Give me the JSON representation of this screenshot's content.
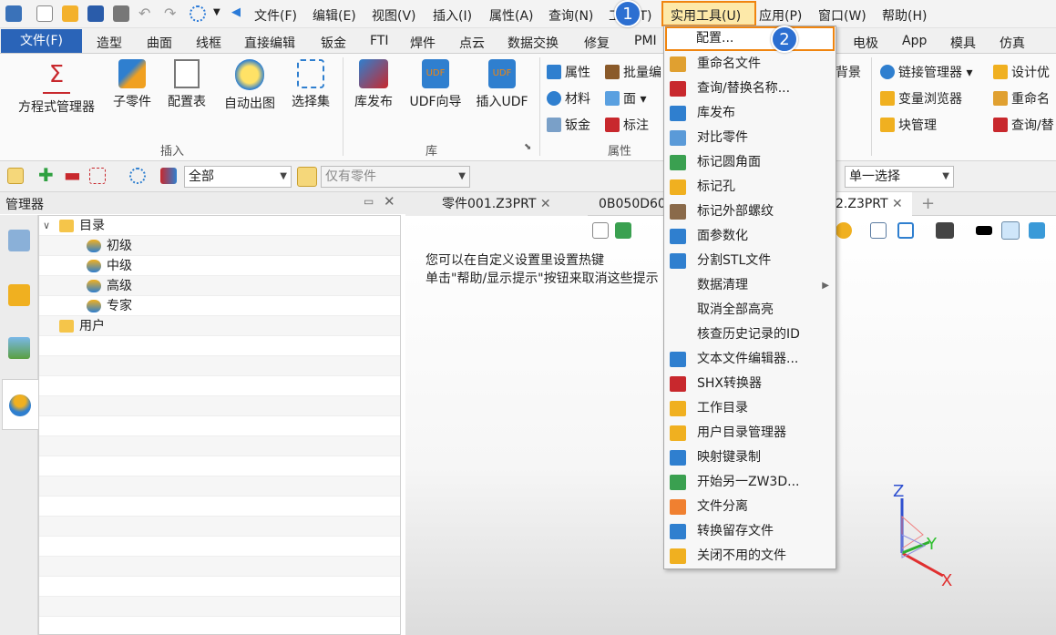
{
  "colors": {
    "accent": "#2a64b8",
    "highlight": "#f0850f",
    "badge": "#2c6fd1"
  },
  "menubar": [
    "文件(F)",
    "编辑(E)",
    "视图(V)",
    "插入(I)",
    "属性(A)",
    "查询(N)",
    "工具(T)",
    "实用工具(U)",
    "应用(P)",
    "窗口(W)",
    "帮助(H)"
  ],
  "ribbon_tabs": [
    "文件(F)",
    "造型",
    "曲面",
    "线框",
    "直接编辑",
    "钣金",
    "FTI",
    "焊件",
    "点云",
    "数据交换",
    "修复",
    "PMI",
    "",
    "电极",
    "App",
    "模具",
    "仿真"
  ],
  "ribbon": {
    "insert": {
      "buttons": [
        "方程式管理器",
        "子零件",
        "配置表",
        "自动出图",
        "选择集"
      ],
      "group": "插入"
    },
    "library": {
      "buttons": [
        "库发布",
        "UDF向导",
        "插入UDF"
      ],
      "group": "库"
    },
    "attributes": {
      "items": [
        "属性",
        "批量编",
        "材料",
        "面",
        "钣金",
        "标注"
      ],
      "group": "属性"
    },
    "bg_label": "背景",
    "right": {
      "items": [
        "链接管理器",
        "设计优",
        "变量浏览器",
        "重命名",
        "块管理",
        "查询/替"
      ]
    }
  },
  "toolbar": {
    "filter_value": "全部",
    "part_filter": "仅有零件",
    "select_mode": "单一选择"
  },
  "manager": {
    "title": "管理器"
  },
  "tree": [
    {
      "label": "目录",
      "level": 0
    },
    {
      "label": "初级",
      "level": 1
    },
    {
      "label": "中级",
      "level": 1
    },
    {
      "label": "高级",
      "level": 1
    },
    {
      "label": "专家",
      "level": 1
    },
    {
      "label": "用户",
      "level": 0
    }
  ],
  "doc_tabs": [
    "零件001.Z3PRT",
    "0B050D60",
    "2.Z3PRT"
  ],
  "hint": {
    "line1": "您可以在自定义设置里设置热键",
    "line2": "单击\"帮助/显示提示\"按钮来取消这些提示"
  },
  "menu_items": [
    "配置...",
    "重命名文件",
    "查询/替换名称...",
    "库发布",
    "对比零件",
    "标记圆角面",
    "标记孔",
    "标记外部螺纹",
    "面参数化",
    "分割STL文件",
    "数据清理",
    "取消全部高亮",
    "核查历史记录的ID",
    "文本文件编辑器...",
    "SHX转换器",
    "工作目录",
    "用户目录管理器",
    "映射键录制",
    "开始另一ZW3D...",
    "文件分离",
    "转换留存文件",
    "关闭不用的文件"
  ],
  "badges": [
    "1",
    "2"
  ],
  "axes": {
    "x": "X",
    "y": "Y",
    "z": "Z"
  },
  "icons": [
    "logo-icon",
    "new-file-icon",
    "open-icon",
    "save-icon",
    "print-icon",
    "undo-icon",
    "redo-icon",
    "refresh-icon"
  ]
}
